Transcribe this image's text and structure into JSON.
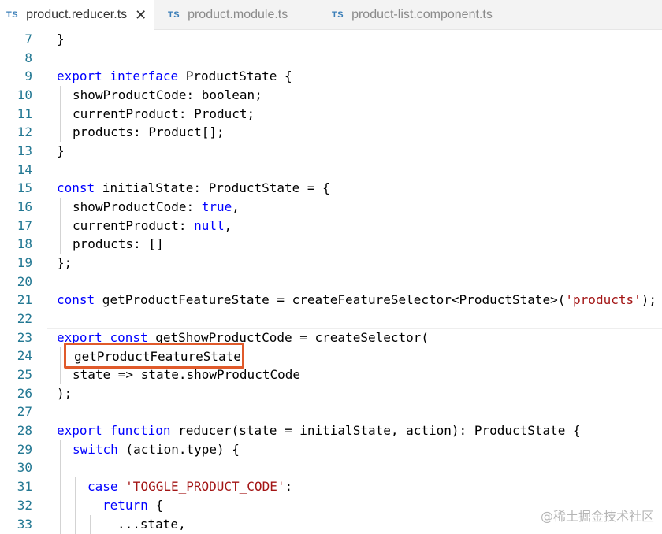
{
  "tabs": [
    {
      "lang": "TS",
      "label": "product.reducer.ts",
      "close": "✕"
    },
    {
      "lang": "TS",
      "label": "product.module.ts"
    },
    {
      "lang": "TS",
      "label": "product-list.component.ts"
    }
  ],
  "lines": [
    {
      "num": "7"
    },
    {
      "num": "8"
    },
    {
      "num": "9",
      "t": [
        "export",
        " ",
        "interface",
        " ProductState {"
      ]
    },
    {
      "num": "10",
      "t": [
        "showProductCode: boolean;"
      ]
    },
    {
      "num": "11",
      "t": [
        "currentProduct: Product;"
      ]
    },
    {
      "num": "12",
      "t": [
        "products: Product[];"
      ]
    },
    {
      "num": "13",
      "t": [
        "}"
      ]
    },
    {
      "num": "14"
    },
    {
      "num": "15",
      "t": [
        "const",
        " initialState: ProductState = {"
      ]
    },
    {
      "num": "16",
      "t": [
        "showProductCode: ",
        "true",
        ","
      ]
    },
    {
      "num": "17",
      "t": [
        "currentProduct: ",
        "null",
        ","
      ]
    },
    {
      "num": "18",
      "t": [
        "products: []"
      ]
    },
    {
      "num": "19",
      "t": [
        "};"
      ]
    },
    {
      "num": "20"
    },
    {
      "num": "21",
      "t": [
        "const",
        " getProductFeatureState = createFeatureSelector<ProductState>(",
        "'products'",
        ");"
      ]
    },
    {
      "num": "22"
    },
    {
      "num": "23",
      "t": [
        "export",
        " ",
        "const",
        " getShowProductCode = createSelector("
      ]
    },
    {
      "num": "24",
      "t": [
        "getProductFeatureState"
      ]
    },
    {
      "num": "25",
      "t": [
        "state => state.showProductCode"
      ]
    },
    {
      "num": "26",
      "t": [
        ");"
      ]
    },
    {
      "num": "27"
    },
    {
      "num": "28",
      "t": [
        "export",
        " ",
        "function",
        " reducer(state = initialState, action): ProductState {"
      ]
    },
    {
      "num": "29",
      "t": [
        "switch",
        " (action.type) {"
      ]
    },
    {
      "num": "30"
    },
    {
      "num": "31",
      "t": [
        "case",
        " ",
        "'TOGGLE_PRODUCT_CODE'",
        ":"
      ]
    },
    {
      "num": "32",
      "t": [
        "return",
        " {"
      ]
    },
    {
      "num": "33",
      "t": [
        "...state,"
      ]
    }
  ],
  "line7_code": "}",
  "highlight_text": "getProductFeatureState",
  "watermark": "@稀土掘金技术社区",
  "colors": {
    "keyword": "#0000ff",
    "string": "#a31515",
    "line_number": "#237893",
    "highlight_border": "#e05a2b"
  }
}
